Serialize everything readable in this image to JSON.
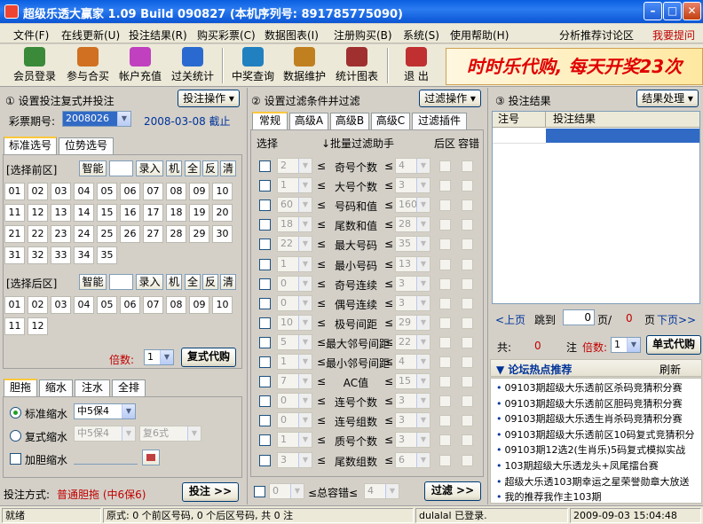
{
  "window": {
    "title": "超级乐透大赢家 1.09 Build 090827 (本机序列号: 891785775090)"
  },
  "menu": [
    "文件(F)",
    "在线更新(U)",
    "投注结果(R)",
    "购买彩票(C)",
    "数据图表(I)",
    "注册购买(B)",
    "系统(S)",
    "使用帮助(H)"
  ],
  "menu_right": {
    "forum": "分析推荐讨论区",
    "ask": "我要提问"
  },
  "toolbar": [
    {
      "label": "会员登录",
      "icon": "member-login-icon",
      "color": "#3a8a3a"
    },
    {
      "label": "参与合买",
      "icon": "group-buy-icon",
      "color": "#d07020"
    },
    {
      "label": "帐户充值",
      "icon": "account-recharge-icon",
      "color": "#c040c0"
    },
    {
      "label": "过关统计",
      "icon": "stats-icon",
      "color": "#2a6ad0"
    },
    {
      "label": "中奖查询",
      "icon": "prize-query-icon",
      "color": "#2080c0"
    },
    {
      "label": "数据维护",
      "icon": "data-maintain-icon",
      "color": "#c08020"
    },
    {
      "label": "统计图表",
      "icon": "chart-icon",
      "color": "#a03030"
    },
    {
      "label": "退 出",
      "icon": "exit-icon",
      "color": "#c03030"
    }
  ],
  "banner": "时时乐代购, 每天开奖23次",
  "left": {
    "section_title": "① 设置投注复式并投注",
    "ops_button": "投注操作 ▾",
    "period_label": "彩票期号:",
    "period_value": "2008026",
    "deadline": "2008-03-08 截止",
    "tabs": [
      "标准选号",
      "位势选号"
    ],
    "front_label": "[选择前区]",
    "back_label": "[选择后区]",
    "smart": "智能",
    "enter": "录入",
    "machine": "机",
    "all": "全",
    "reverse": "反",
    "clear": "清",
    "front_numbers": [
      "01",
      "02",
      "03",
      "04",
      "05",
      "06",
      "07",
      "08",
      "09",
      "10",
      "11",
      "12",
      "13",
      "14",
      "15",
      "16",
      "17",
      "18",
      "19",
      "20",
      "21",
      "22",
      "23",
      "24",
      "25",
      "26",
      "27",
      "28",
      "29",
      "30",
      "31",
      "32",
      "33",
      "34",
      "35"
    ],
    "back_numbers": [
      "01",
      "02",
      "03",
      "04",
      "05",
      "06",
      "07",
      "08",
      "09",
      "10",
      "11",
      "12"
    ],
    "multiple_label": "倍数:",
    "multiple_value": "1",
    "compound_buy": "复式代购",
    "bottom_tabs": [
      "胆拖",
      "缩水",
      "注水",
      "全排"
    ],
    "std_shrink_label": "标准缩水",
    "std_shrink_value": "中5保4",
    "comp_shrink_label": "复式缩水",
    "comp_shrink_value1": "中5保4",
    "comp_shrink_value2": "复6式",
    "add_shrink_label": "加胆缩水",
    "bet_mode_label": "投注方式:",
    "bet_mode_value": "普通胆拖 (中6保6)",
    "bet_button": "投注 >>"
  },
  "middle": {
    "section_title": "② 设置过滤条件并过滤",
    "ops_button": "过滤操作 ▾",
    "tabs": [
      "常规",
      "高级A",
      "高级B",
      "高级C",
      "过滤插件"
    ],
    "col_select": "选择",
    "col_helper": "↓批量过滤助手",
    "col_back": "后区",
    "col_tol": "容错",
    "rows": [
      {
        "min": "2",
        "label": "奇号个数",
        "max": "4"
      },
      {
        "min": "1",
        "label": "大号个数",
        "max": "3"
      },
      {
        "min": "60",
        "label": "号码和值",
        "max": "160"
      },
      {
        "min": "18",
        "label": "尾数和值",
        "max": "28"
      },
      {
        "min": "22",
        "label": "最大号码",
        "max": "35"
      },
      {
        "min": "1",
        "label": "最小号码",
        "max": "13"
      },
      {
        "min": "0",
        "label": "奇号连续",
        "max": "3"
      },
      {
        "min": "0",
        "label": "偶号连续",
        "max": "3"
      },
      {
        "min": "10",
        "label": "极号间距",
        "max": "29"
      },
      {
        "min": "5",
        "label": "最大邻号间距",
        "max": "22"
      },
      {
        "min": "1",
        "label": "最小邻号间距",
        "max": "4"
      },
      {
        "min": "7",
        "label": "AC值",
        "max": "15"
      },
      {
        "min": "0",
        "label": "连号个数",
        "max": "3"
      },
      {
        "min": "0",
        "label": "连号组数",
        "max": "3"
      },
      {
        "min": "1",
        "label": "质号个数",
        "max": "3"
      },
      {
        "min": "3",
        "label": "尾数组数",
        "max": "6"
      }
    ],
    "le": "≤",
    "total_tol_min": "0",
    "total_tol_label": "≤总容错≤",
    "total_tol_max": "4",
    "filter_button": "过滤 >>"
  },
  "right": {
    "section_title": "③ 投注结果",
    "ops_button": "结果处理 ▾",
    "col_no": "注号",
    "col_result": "投注结果",
    "prev": "<上页",
    "jump": "跳到",
    "page_value": "0",
    "page_sep": "页/",
    "page_total": "0",
    "page_unit": "页",
    "next": "下页>>",
    "total_label": "共:",
    "total_value": "0",
    "bets_label": "注",
    "multiple_label": "倍数:",
    "multiple_value": "1",
    "buy_button": "单式代购",
    "forum_title": "▼ 论坛热点推荐",
    "refresh": "刷新",
    "forum_items": [
      "09103期超级大乐透前区杀码竞猜积分赛",
      "09103期超级大乐透前区胆码竞猜积分赛",
      "09103期超级大乐透生肖杀码竞猜积分赛",
      "09103期超级大乐透前区10码复式竞猜积分",
      "09103期12选2(生肖乐)5码复式模拟实战",
      "103期超级大乐透龙头+凤尾擂台赛",
      "超级大乐透103期幸运之星荣誉勋章大放送",
      "我的推荐我作主103期"
    ]
  },
  "status": {
    "ready": "就绪",
    "info": "原式: 0 个前区号码, 0 个后区号码, 共 0 注",
    "user": "dulalal 已登录.",
    "time": "2009-09-03 15:04:48"
  }
}
